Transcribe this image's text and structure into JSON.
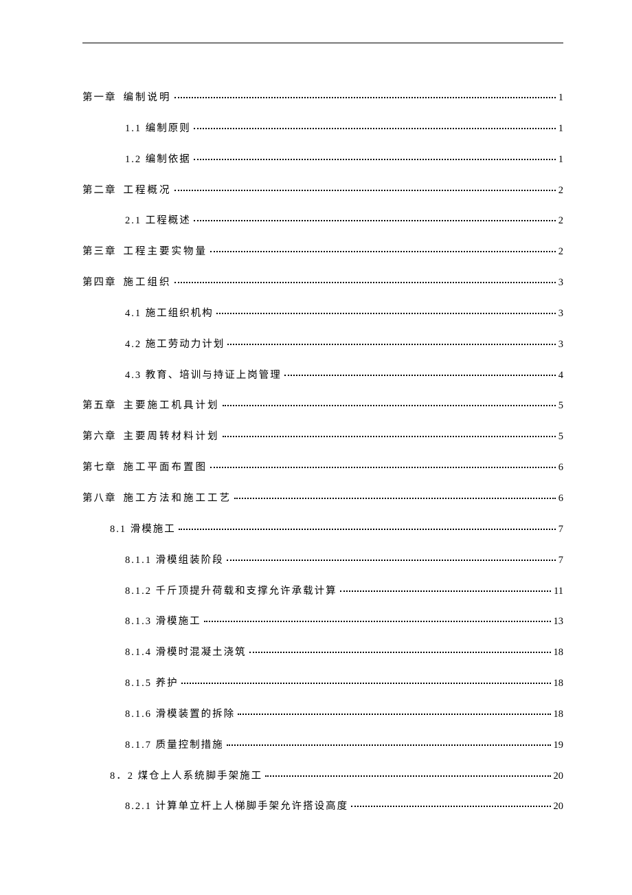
{
  "toc": [
    {
      "level": 1,
      "chapter": "第一章",
      "title": "编制说明",
      "page": "1"
    },
    {
      "level": 2,
      "chapter": "",
      "title": "1.1 编制原则",
      "page": "1"
    },
    {
      "level": 2,
      "chapter": "",
      "title": "1.2 编制依据",
      "page": "1"
    },
    {
      "level": 1,
      "chapter": "第二章",
      "title": "工程概况",
      "page": "2"
    },
    {
      "level": 2,
      "chapter": "",
      "title": "2.1 工程概述",
      "page": "2"
    },
    {
      "level": 1,
      "chapter": "第三章",
      "title": " 工程主要实物量",
      "page": "2"
    },
    {
      "level": 1,
      "chapter": "第四章",
      "title": "  施工组织",
      "page": "3"
    },
    {
      "level": 2,
      "chapter": "",
      "title": "4.1 施工组织机构",
      "page": "3"
    },
    {
      "level": 2,
      "chapter": "",
      "title": "4.2 施工劳动力计划",
      "page": "3"
    },
    {
      "level": 2,
      "chapter": "",
      "title": "4.3 教育、培训与持证上岗管理",
      "page": "4"
    },
    {
      "level": 1,
      "chapter": "第五章",
      "title": "  主要施工机具计划",
      "page": "5"
    },
    {
      "level": 1,
      "chapter": "第六章",
      "title": "  主要周转材料计划",
      "page": "5"
    },
    {
      "level": 1,
      "chapter": "第七章",
      "title": "  施工平面布置图",
      "page": "6"
    },
    {
      "level": 1,
      "chapter": "第八章",
      "title": "  施工方法和施工工艺",
      "page": "6"
    },
    {
      "level": 3,
      "chapter": "",
      "title": "8.1 滑模施工",
      "page": "7"
    },
    {
      "level": 2,
      "chapter": "",
      "title": "8.1.1 滑模组装阶段",
      "page": "7"
    },
    {
      "level": 2,
      "chapter": "",
      "title": "8.1.2 千斤顶提升荷载和支撑允许承载计算",
      "page": "11"
    },
    {
      "level": 2,
      "chapter": "",
      "title": "8.1.3 滑模施工",
      "page": "13"
    },
    {
      "level": 2,
      "chapter": "",
      "title": "8.1.4 滑模时混凝土浇筑",
      "page": "18"
    },
    {
      "level": 2,
      "chapter": "",
      "title": "8.1.5 养护",
      "page": "18"
    },
    {
      "level": 2,
      "chapter": "",
      "title": "8.1.6 滑模装置的拆除",
      "page": "18"
    },
    {
      "level": 2,
      "chapter": "",
      "title": "8.1.7 质量控制措施",
      "page": "19"
    },
    {
      "level": 3,
      "chapter": "",
      "title": "8．2 煤仓上人系统脚手架施工",
      "page": "20"
    },
    {
      "level": 2,
      "chapter": "",
      "title": "8.2.1 计算单立杆上人梯脚手架允许搭设高度",
      "page": "20"
    }
  ]
}
